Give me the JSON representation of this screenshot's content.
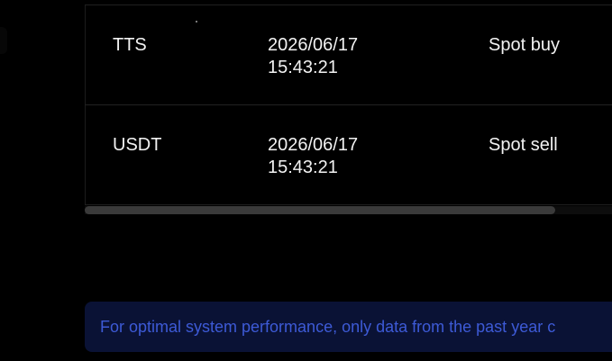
{
  "table": {
    "rows": [
      {
        "coin": "TTS",
        "time": "2026/06/17 15:43:21",
        "type": "Spot buy"
      },
      {
        "coin": "USDT",
        "time": "2026/06/17 15:43:21",
        "type": "Spot sell"
      }
    ],
    "horizontal_scroll_position": 0
  },
  "notice": {
    "text": "For optimal system performance, only data from the past year c"
  },
  "colors": {
    "background": "#000000",
    "row_text": "#f2f2f2",
    "notice_background": "#0a1235",
    "notice_text": "#3d5ad6",
    "scrollbar_thumb": "#3a3a3a"
  }
}
